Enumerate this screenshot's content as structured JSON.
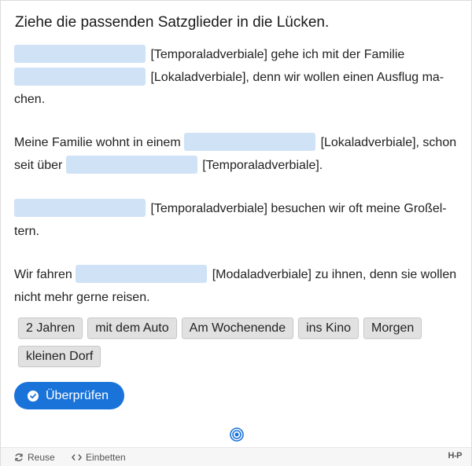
{
  "title": "Ziehe die passenden Satzglieder in die Lücken.",
  "paragraphs": [
    {
      "p1a": "[Temporaladverbiale] gehe ich mit der Familie",
      "p1b": "[Lokaladverbiale], denn wir wollen einen Ausflug ma-",
      "p1c": "chen."
    },
    {
      "p2a": "Meine Familie wohnt in einem",
      "p2b": "[Lokaladverbiale], schon",
      "p2c": "seit über",
      "p2d": "[Temporaladverbiale]."
    },
    {
      "p3a": "[Temporaladverbiale] besuchen wir oft meine Großel-",
      "p3b": "tern."
    },
    {
      "p4a": "Wir fahren",
      "p4b": "[Modaladverbiale] zu ihnen, denn sie wollen",
      "p4c": "nicht mehr gerne reisen."
    }
  ],
  "draggables": [
    "2 Jahren",
    "mit dem Auto",
    "Am Wochenende",
    "ins Kino",
    "Morgen",
    "kleinen Dorf"
  ],
  "check_button": "Überprüfen",
  "footer": {
    "reuse": "Reuse",
    "embed": "Einbetten",
    "brand": "H-P"
  },
  "colors": {
    "accent": "#1a73d9",
    "blank": "#cfe2f6"
  }
}
